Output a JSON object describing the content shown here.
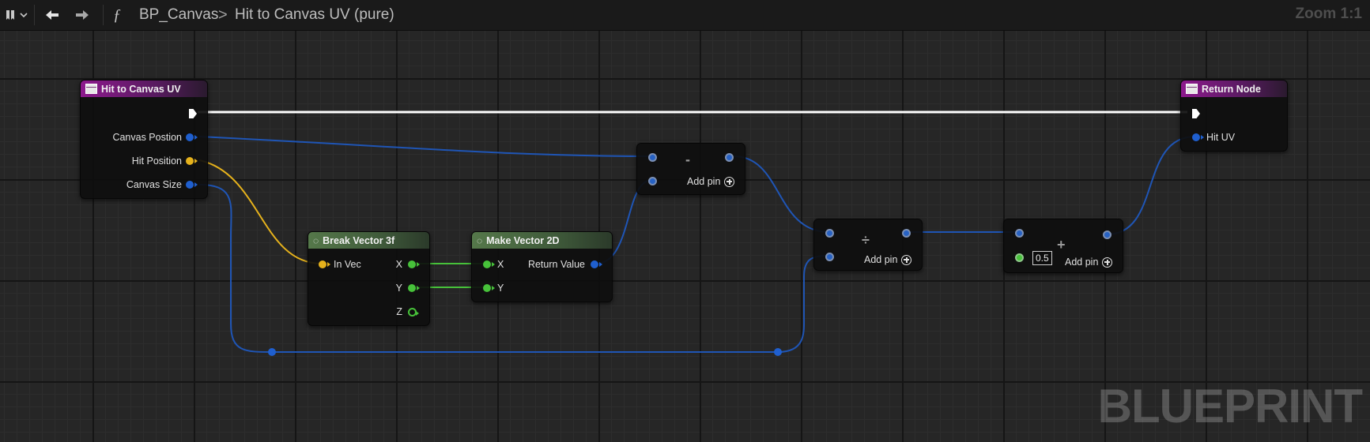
{
  "toolbar": {
    "function_glyph": "ƒ",
    "breadcrumb_blueprint": "BP_Canvas",
    "breadcrumb_separator": ">",
    "breadcrumb_function": "Hit to Canvas UV (pure)",
    "zoom": "Zoom 1:1",
    "icons": [
      "bookmark-icon",
      "chevron-down-icon",
      "back-arrow-icon",
      "forward-arrow-icon"
    ]
  },
  "watermark": "BLUEPRINT",
  "nodes": {
    "entry": {
      "title": "Hit to Canvas UV",
      "pins": [
        "Canvas Postion",
        "Hit Position",
        "Canvas Size"
      ]
    },
    "break_vector": {
      "title": "Break Vector 3f",
      "input": "In Vec",
      "outputs": [
        "X",
        "Y",
        "Z"
      ]
    },
    "make_vector": {
      "title": "Make Vector 2D",
      "inputs": [
        "X",
        "Y"
      ],
      "output": "Return Value"
    },
    "subtract": {
      "operator": "-",
      "add_pin": "Add pin"
    },
    "divide": {
      "operator": "÷",
      "add_pin": "Add pin"
    },
    "add": {
      "operator": "+",
      "default_value": "0.5",
      "add_pin": "Add pin"
    },
    "return": {
      "title": "Return Node",
      "pin": "Hit UV"
    }
  },
  "colors": {
    "vector2d_pin": "#1f5fcf",
    "vector3_pin": "#e6b21c",
    "float_pin": "#47c23a",
    "exec_wire": "#ffffff",
    "function_header": "#8d1a8d",
    "pure_header": "#55784a"
  }
}
